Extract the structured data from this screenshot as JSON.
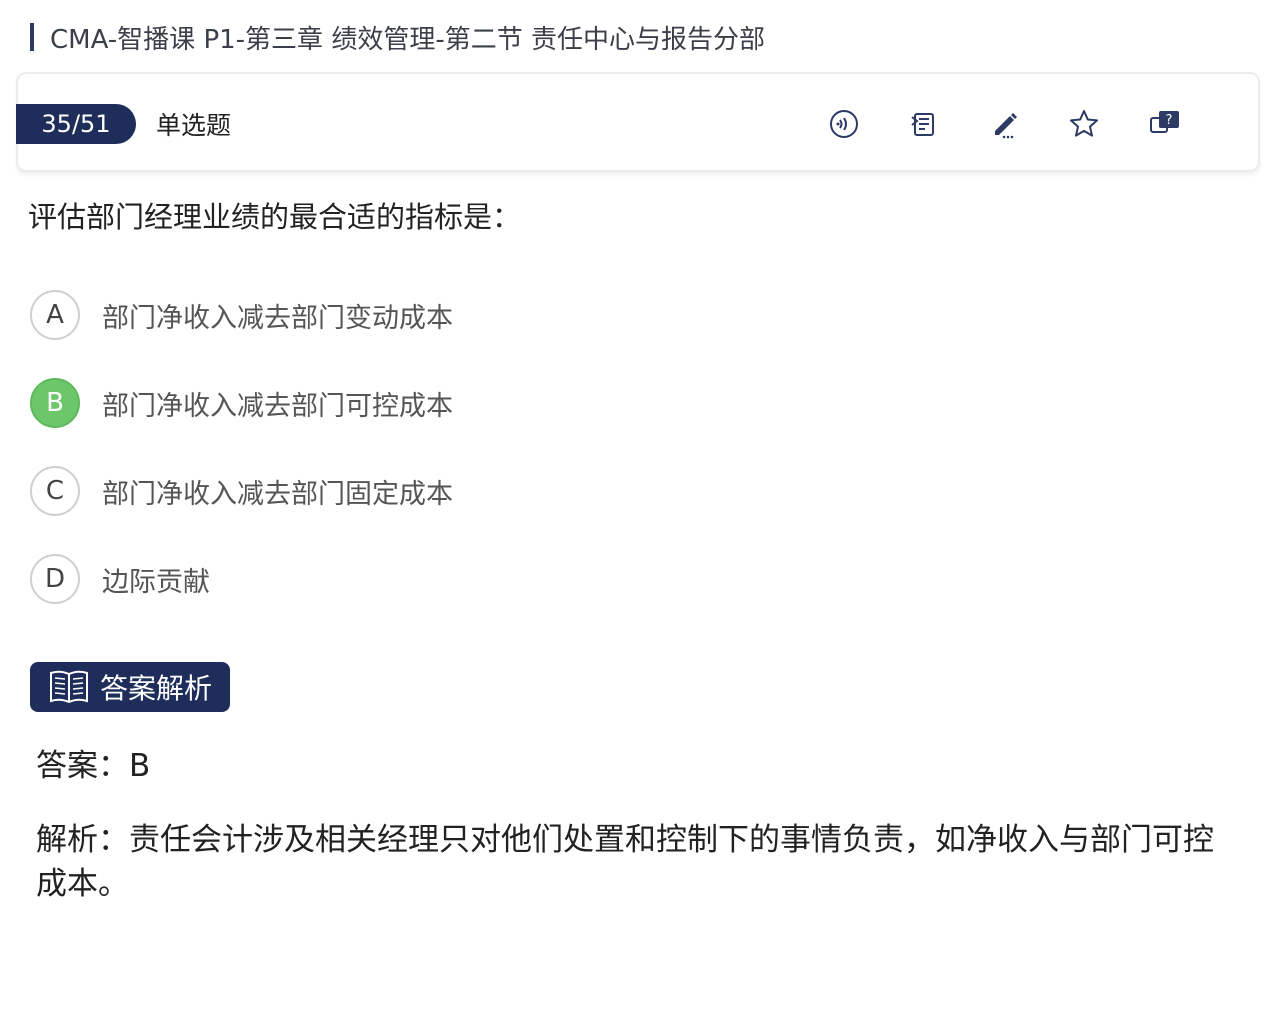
{
  "header": {
    "title": "CMA-智播课 P1-第三章 绩效管理-第二节 责任中心与报告分部"
  },
  "toolbar": {
    "progress": "35/51",
    "question_type": "单选题",
    "icons": [
      "audio-icon",
      "notes-icon",
      "edit-icon",
      "star-icon",
      "question-chat-icon"
    ]
  },
  "question": {
    "text": "评估部门经理业绩的最合适的指标是："
  },
  "options": [
    {
      "letter": "A",
      "text": "部门净收入减去部门变动成本"
    },
    {
      "letter": "B",
      "text": "部门净收入减去部门可控成本"
    },
    {
      "letter": "C",
      "text": "部门净收入减去部门固定成本"
    },
    {
      "letter": "D",
      "text": "边际贡献"
    }
  ],
  "analysis": {
    "tag_label": "答案解析",
    "answer_label": "答案：",
    "answer_value": "B",
    "explain_label": "解析：",
    "explain_text": "责任会计涉及相关经理只对他们处置和控制下的事情负责，如净收入与部门可控成本。"
  },
  "colors": {
    "accent": "#1e2d5a",
    "correct": "#6cc76a"
  }
}
